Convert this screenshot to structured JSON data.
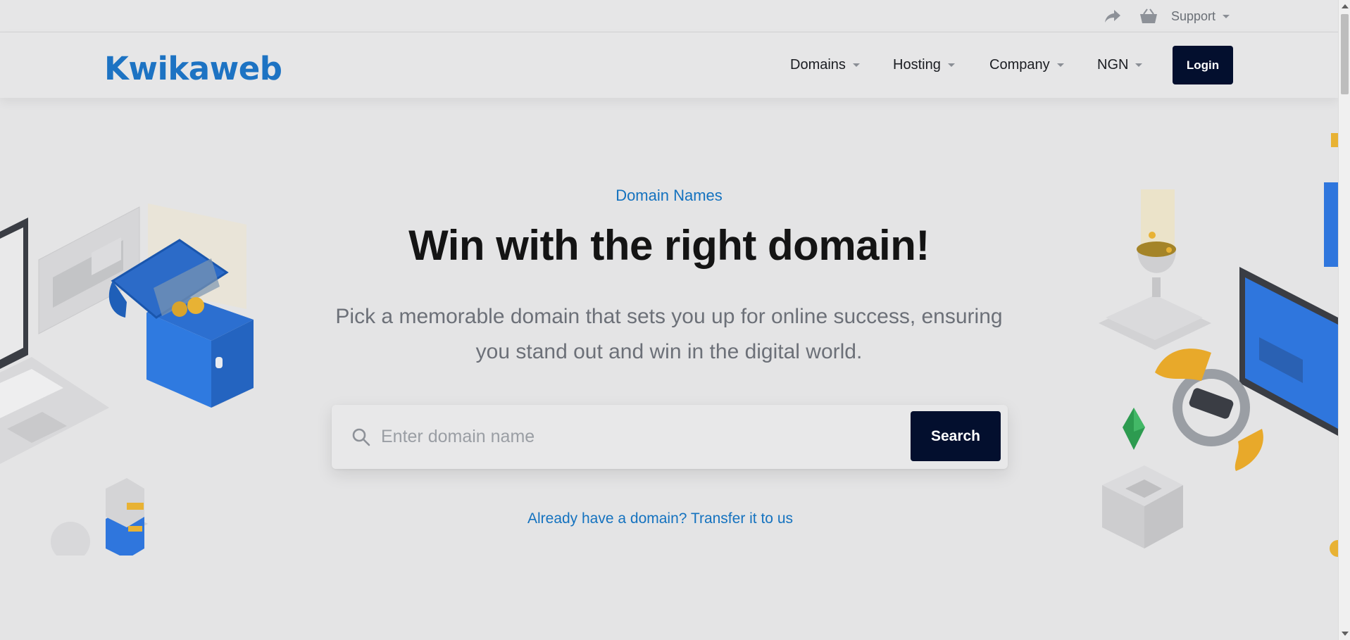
{
  "topbar": {
    "share_icon": "share-arrow-icon",
    "basket_icon": "shopping-basket-icon",
    "support_label": "Support"
  },
  "header": {
    "logo_text": "Kwikaweb",
    "nav": [
      {
        "label": "Domains"
      },
      {
        "label": "Hosting"
      },
      {
        "label": "Company"
      },
      {
        "label": "NGN"
      }
    ],
    "login_label": "Login"
  },
  "hero": {
    "eyebrow": "Domain Names",
    "headline": "Win with the right domain!",
    "subtext": "Pick a memorable domain that sets you up for online success, ensuring you stand out and win in the digital world.",
    "search": {
      "placeholder": "Enter domain name",
      "button_label": "Search"
    },
    "transfer_link": "Already have a domain? Transfer it to us"
  },
  "colors": {
    "brand_blue": "#1d73c3",
    "link_blue": "#1472bf",
    "button_navy": "#030f2e",
    "background": "#e4e4e5"
  }
}
